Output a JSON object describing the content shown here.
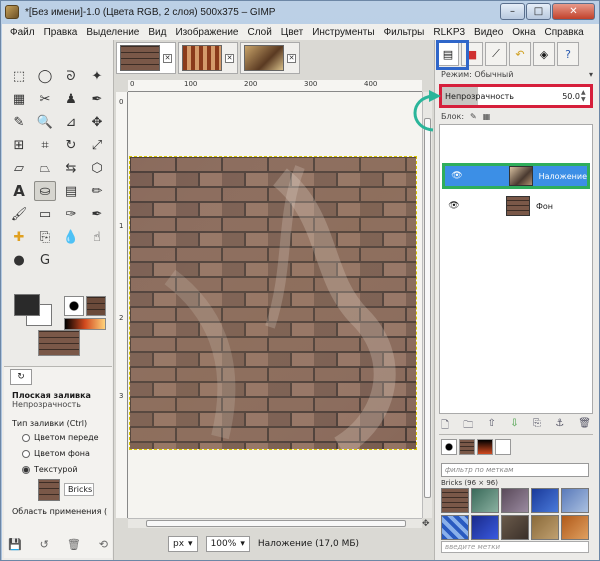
{
  "window": {
    "title": "*[Без имени]-1.0 (Цвета RGB, 2 слоя) 500x375 – GIMP",
    "min": "–",
    "max": "□",
    "close": "✕"
  },
  "menu": [
    "Файл",
    "Правка",
    "Выделение",
    "Вид",
    "Изображение",
    "Слой",
    "Цвет",
    "Инструменты",
    "Фильтры",
    "RLKP3",
    "Видео",
    "Окна",
    "Справка"
  ],
  "rulers": {
    "h": [
      "0",
      "100",
      "200",
      "300",
      "400"
    ],
    "v": [
      "0",
      "1",
      "2",
      "3"
    ]
  },
  "tool_options": {
    "tab_icon": "↻",
    "title": "Плоская заливка",
    "subtitle": "Непрозрачность",
    "fill_type_label": "Тип заливки (Ctrl)",
    "fill_options": [
      "Цветом переде",
      "Цветом фона",
      "Текстурой"
    ],
    "selected_fill": 2,
    "pattern_name": "Bricks",
    "area_label": "Область применения ("
  },
  "statusbar": {
    "unit": "px",
    "zoom": "100%",
    "info": "Наложение (17,0 МБ)"
  },
  "layers": {
    "mode_label": "Режим: Обычный",
    "opacity_label": "Непрозрачность",
    "opacity_value": "50.0",
    "opacity_fraction": 0.5,
    "lock_label": "Блок:",
    "items": [
      {
        "name": "Наложение",
        "selected": true
      },
      {
        "name": "Фон",
        "selected": false
      }
    ]
  },
  "brushes": {
    "filter_placeholder": "фильтр по меткам",
    "pattern_label": "Bricks (96 × 96)",
    "tags_placeholder": "введите метки"
  },
  "colors": {
    "highlight_blue": "#2f66c9",
    "highlight_red": "#d61f3b",
    "highlight_green": "#2fae5c",
    "selected_layer": "#3c8fe6",
    "arrow": "#2ab59a"
  }
}
